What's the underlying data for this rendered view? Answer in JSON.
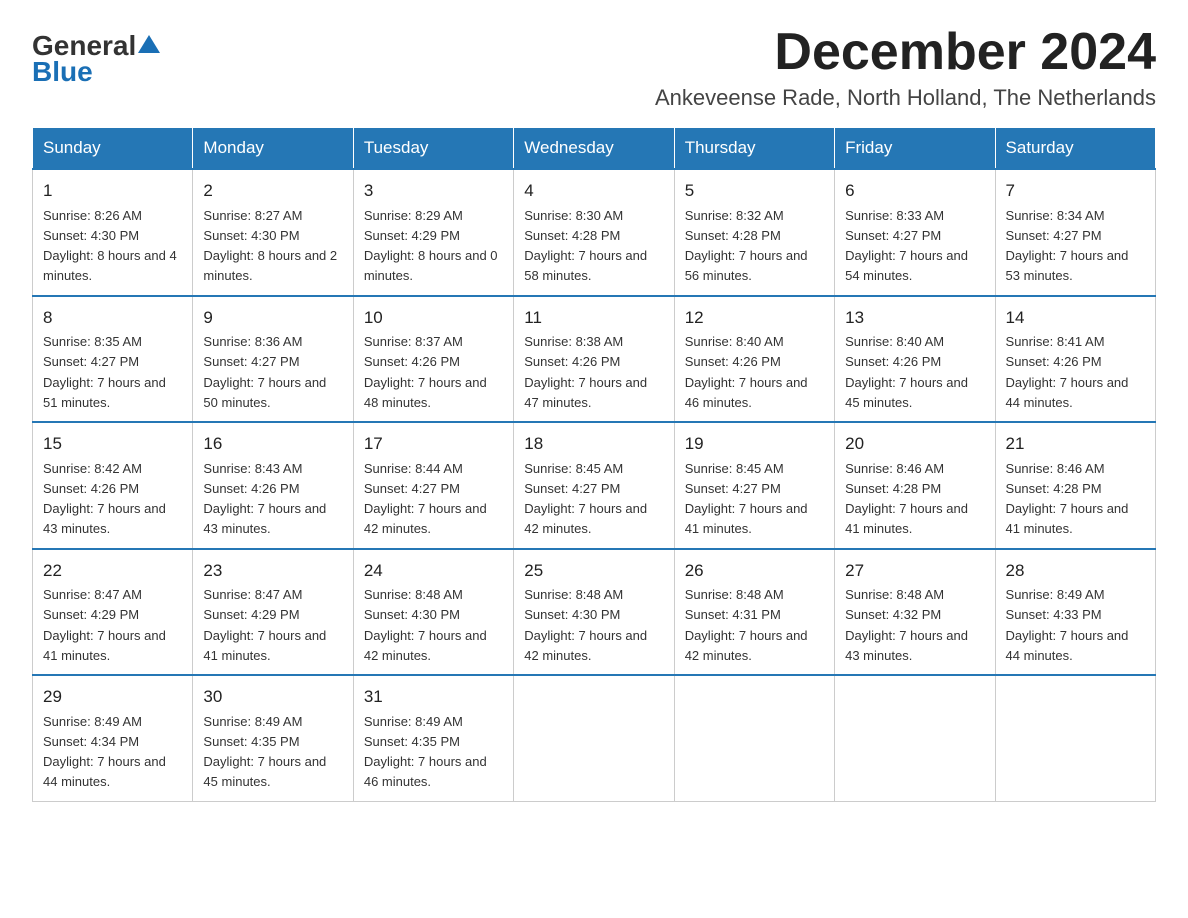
{
  "logo": {
    "text_general": "General",
    "text_blue": "Blue"
  },
  "header": {
    "month_year": "December 2024",
    "location": "Ankeveense Rade, North Holland, The Netherlands"
  },
  "days_of_week": [
    "Sunday",
    "Monday",
    "Tuesday",
    "Wednesday",
    "Thursday",
    "Friday",
    "Saturday"
  ],
  "weeks": [
    [
      {
        "day": "1",
        "sunrise": "8:26 AM",
        "sunset": "4:30 PM",
        "daylight": "8 hours and 4 minutes."
      },
      {
        "day": "2",
        "sunrise": "8:27 AM",
        "sunset": "4:30 PM",
        "daylight": "8 hours and 2 minutes."
      },
      {
        "day": "3",
        "sunrise": "8:29 AM",
        "sunset": "4:29 PM",
        "daylight": "8 hours and 0 minutes."
      },
      {
        "day": "4",
        "sunrise": "8:30 AM",
        "sunset": "4:28 PM",
        "daylight": "7 hours and 58 minutes."
      },
      {
        "day": "5",
        "sunrise": "8:32 AM",
        "sunset": "4:28 PM",
        "daylight": "7 hours and 56 minutes."
      },
      {
        "day": "6",
        "sunrise": "8:33 AM",
        "sunset": "4:27 PM",
        "daylight": "7 hours and 54 minutes."
      },
      {
        "day": "7",
        "sunrise": "8:34 AM",
        "sunset": "4:27 PM",
        "daylight": "7 hours and 53 minutes."
      }
    ],
    [
      {
        "day": "8",
        "sunrise": "8:35 AM",
        "sunset": "4:27 PM",
        "daylight": "7 hours and 51 minutes."
      },
      {
        "day": "9",
        "sunrise": "8:36 AM",
        "sunset": "4:27 PM",
        "daylight": "7 hours and 50 minutes."
      },
      {
        "day": "10",
        "sunrise": "8:37 AM",
        "sunset": "4:26 PM",
        "daylight": "7 hours and 48 minutes."
      },
      {
        "day": "11",
        "sunrise": "8:38 AM",
        "sunset": "4:26 PM",
        "daylight": "7 hours and 47 minutes."
      },
      {
        "day": "12",
        "sunrise": "8:40 AM",
        "sunset": "4:26 PM",
        "daylight": "7 hours and 46 minutes."
      },
      {
        "day": "13",
        "sunrise": "8:40 AM",
        "sunset": "4:26 PM",
        "daylight": "7 hours and 45 minutes."
      },
      {
        "day": "14",
        "sunrise": "8:41 AM",
        "sunset": "4:26 PM",
        "daylight": "7 hours and 44 minutes."
      }
    ],
    [
      {
        "day": "15",
        "sunrise": "8:42 AM",
        "sunset": "4:26 PM",
        "daylight": "7 hours and 43 minutes."
      },
      {
        "day": "16",
        "sunrise": "8:43 AM",
        "sunset": "4:26 PM",
        "daylight": "7 hours and 43 minutes."
      },
      {
        "day": "17",
        "sunrise": "8:44 AM",
        "sunset": "4:27 PM",
        "daylight": "7 hours and 42 minutes."
      },
      {
        "day": "18",
        "sunrise": "8:45 AM",
        "sunset": "4:27 PM",
        "daylight": "7 hours and 42 minutes."
      },
      {
        "day": "19",
        "sunrise": "8:45 AM",
        "sunset": "4:27 PM",
        "daylight": "7 hours and 41 minutes."
      },
      {
        "day": "20",
        "sunrise": "8:46 AM",
        "sunset": "4:28 PM",
        "daylight": "7 hours and 41 minutes."
      },
      {
        "day": "21",
        "sunrise": "8:46 AM",
        "sunset": "4:28 PM",
        "daylight": "7 hours and 41 minutes."
      }
    ],
    [
      {
        "day": "22",
        "sunrise": "8:47 AM",
        "sunset": "4:29 PM",
        "daylight": "7 hours and 41 minutes."
      },
      {
        "day": "23",
        "sunrise": "8:47 AM",
        "sunset": "4:29 PM",
        "daylight": "7 hours and 41 minutes."
      },
      {
        "day": "24",
        "sunrise": "8:48 AM",
        "sunset": "4:30 PM",
        "daylight": "7 hours and 42 minutes."
      },
      {
        "day": "25",
        "sunrise": "8:48 AM",
        "sunset": "4:30 PM",
        "daylight": "7 hours and 42 minutes."
      },
      {
        "day": "26",
        "sunrise": "8:48 AM",
        "sunset": "4:31 PM",
        "daylight": "7 hours and 42 minutes."
      },
      {
        "day": "27",
        "sunrise": "8:48 AM",
        "sunset": "4:32 PM",
        "daylight": "7 hours and 43 minutes."
      },
      {
        "day": "28",
        "sunrise": "8:49 AM",
        "sunset": "4:33 PM",
        "daylight": "7 hours and 44 minutes."
      }
    ],
    [
      {
        "day": "29",
        "sunrise": "8:49 AM",
        "sunset": "4:34 PM",
        "daylight": "7 hours and 44 minutes."
      },
      {
        "day": "30",
        "sunrise": "8:49 AM",
        "sunset": "4:35 PM",
        "daylight": "7 hours and 45 minutes."
      },
      {
        "day": "31",
        "sunrise": "8:49 AM",
        "sunset": "4:35 PM",
        "daylight": "7 hours and 46 minutes."
      },
      null,
      null,
      null,
      null
    ]
  ]
}
